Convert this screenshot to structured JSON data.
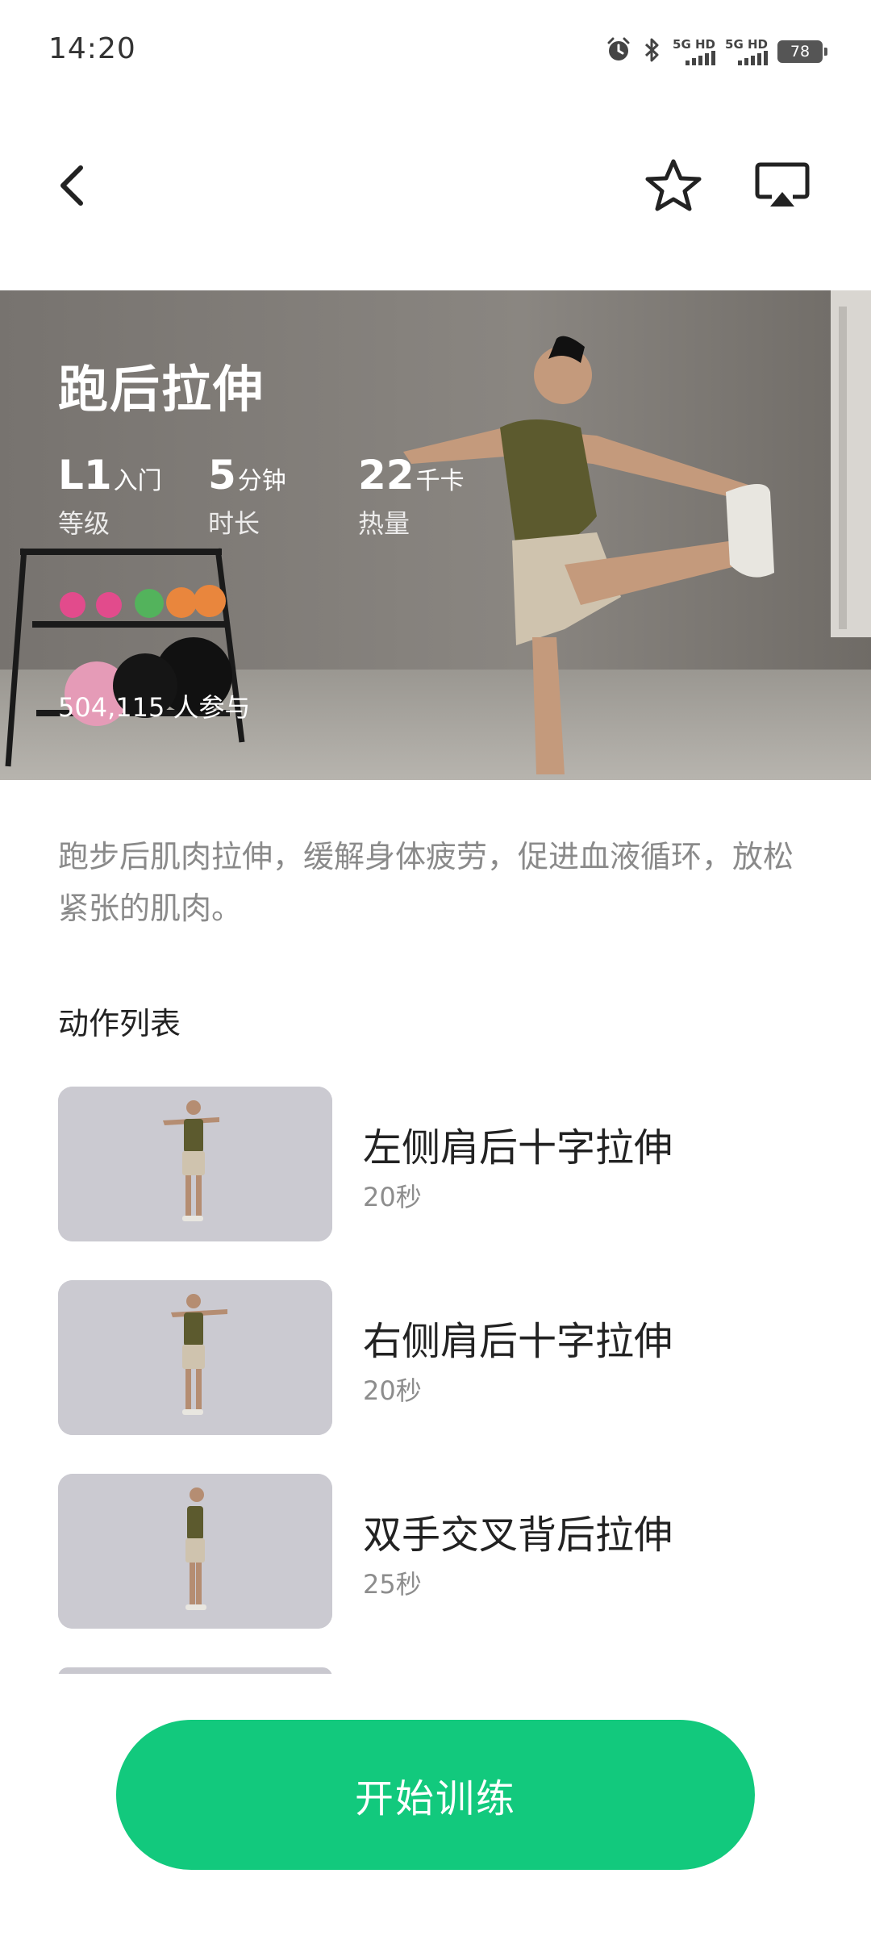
{
  "status_bar": {
    "time": "14:20",
    "sim1_label": "5G HD",
    "sim2_label": "5G HD",
    "battery": "78",
    "icons": [
      "alarm-icon",
      "bluetooth-icon",
      "signal-icon",
      "battery-icon"
    ]
  },
  "nav": {
    "back_icon": "chevron-left-icon",
    "favorite_icon": "star-outline-icon",
    "cast_icon": "screen-cast-icon"
  },
  "hero": {
    "title": "跑后拉伸",
    "stats": [
      {
        "value": "L1",
        "unit": "入门",
        "label": "等级"
      },
      {
        "value": "5",
        "unit": "分钟",
        "label": "时长"
      },
      {
        "value": "22",
        "unit": "千卡",
        "label": "热量"
      }
    ],
    "participants": "504,115 人参与"
  },
  "description": "跑步后肌肉拉伸，缓解身体疲劳，促进血液循环，放松紧张的肌肉。",
  "section_title": "动作列表",
  "exercises": [
    {
      "name": "左侧肩后十字拉伸",
      "duration": "20秒"
    },
    {
      "name": "右侧肩后十字拉伸",
      "duration": "20秒"
    },
    {
      "name": "双手交叉背后拉伸",
      "duration": "25秒"
    }
  ],
  "start_button": "开始训练",
  "colors": {
    "accent": "#12c97d",
    "muted_text": "#8a8a8a",
    "thumb_bg": "#c9c8cf"
  }
}
